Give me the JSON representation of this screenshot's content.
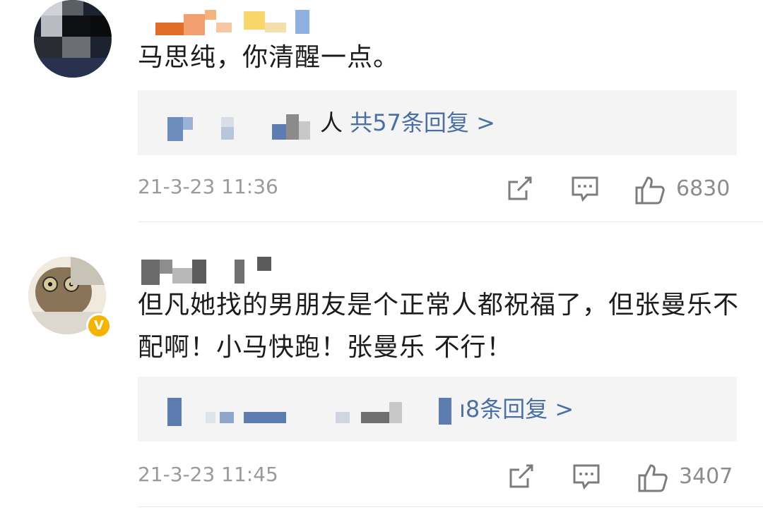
{
  "comments": [
    {
      "text": "马思纯，你清醒一点。",
      "reply_prefix": "人",
      "reply_count_label": "共57条回复 >",
      "timestamp": "21-3-23 11:36",
      "likes": "6830",
      "verified": false
    },
    {
      "text": "但凡她找的男朋友是个正常人都祝福了，但张曼乐不配啊！小马快跑！张曼乐 不行！",
      "reply_prefix": "",
      "reply_count_label": "ı8条回复 >",
      "timestamp": "21-3-23 11:45",
      "likes": "3407",
      "verified": true,
      "badge": "V"
    }
  ],
  "colors": {
    "link": "#4a6fa5",
    "meta": "#9a9a9a",
    "reply_bg": "#f4f4f4",
    "badge": "#f4b400"
  },
  "icons": [
    "share-icon",
    "comment-icon",
    "like-icon",
    "verified-badge-icon"
  ]
}
